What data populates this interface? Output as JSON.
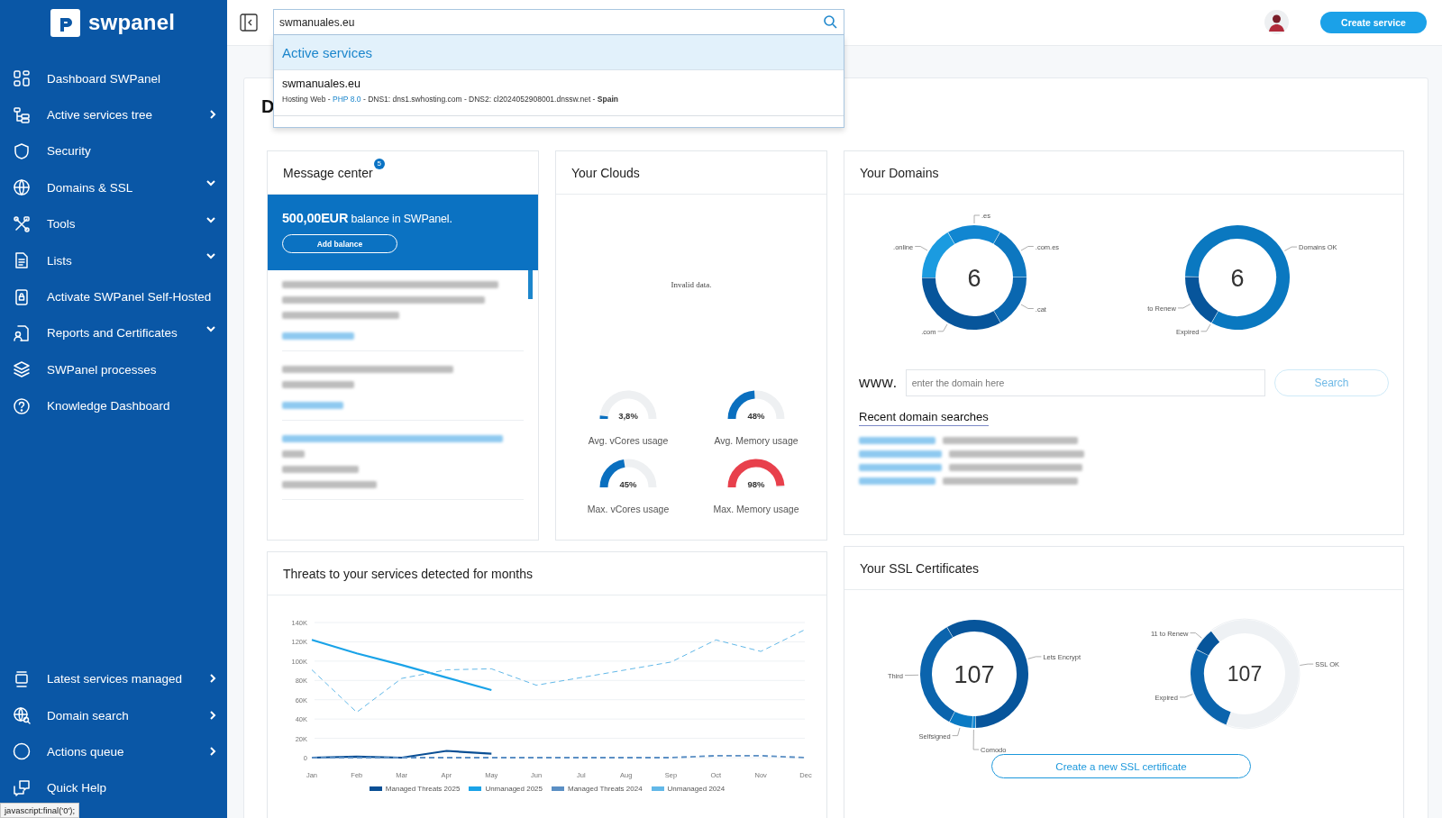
{
  "sidebar": {
    "logo_text": "swpanel",
    "items": [
      {
        "label": "Dashboard SWPanel",
        "kind": "link"
      },
      {
        "label": "Active services tree",
        "kind": "submenu"
      },
      {
        "label": "Security",
        "kind": "link"
      },
      {
        "label": "Domains & SSL",
        "kind": "dropdown"
      },
      {
        "label": "Tools",
        "kind": "dropdown"
      },
      {
        "label": "Lists",
        "kind": "dropdown"
      },
      {
        "label": "Activate SWPanel Self-Hosted",
        "kind": "link"
      },
      {
        "label": "Reports and Certificates",
        "kind": "dropdown"
      },
      {
        "label": "SWPanel processes",
        "kind": "link"
      },
      {
        "label": "Knowledge Dashboard",
        "kind": "link"
      }
    ],
    "bottom_items": [
      {
        "label": "Latest services managed",
        "kind": "submenu"
      },
      {
        "label": "Domain search",
        "kind": "submenu"
      },
      {
        "label": "Actions queue",
        "kind": "submenu"
      },
      {
        "label": "Quick Help",
        "kind": "link"
      }
    ]
  },
  "header": {
    "search_value": "swmanuales.eu",
    "create_button": "Create service"
  },
  "search_results": {
    "group": "Active services",
    "results": [
      {
        "title": "swmanuales.eu",
        "detail_parts": [
          {
            "kind": "plain",
            "text": "Hosting Web - "
          },
          {
            "kind": "accent",
            "text": "PHP 8.0"
          },
          {
            "kind": "plain",
            "text": " - DNS1: dns1.swhosting.com - DNS2: cl2024052908001.dnssw.net - "
          },
          {
            "kind": "bold",
            "text": "Spain"
          }
        ]
      }
    ]
  },
  "page_heading": "D",
  "message_center": {
    "title": "Message center",
    "badge": "5",
    "balance": "**500,00EUR** balance in SWPanel.",
    "button": "Add balance"
  },
  "clouds": {
    "title": "Your Clouds",
    "notice": "Invalid data.",
    "gauges": [
      {
        "label": "Avg. vCores usage",
        "reading": "3,8%",
        "level": 0.038,
        "color": "#0a6fbf"
      },
      {
        "label": "Avg. Memory usage",
        "reading": "48%",
        "level": 0.48,
        "color": "#0a6fbf"
      },
      {
        "label": "Max. vCores usage",
        "reading": "45%",
        "level": 0.45,
        "color": "#0a6fbf"
      },
      {
        "label": "Max. Memory usage",
        "reading": "98%",
        "level": 0.98,
        "color": "#e8404c"
      }
    ]
  },
  "domains": {
    "title": "Your Domains",
    "charts": [
      {
        "center": "6",
        "labels": [
          ".online",
          ".es",
          ".com.es",
          ".cat",
          ".com"
        ]
      },
      {
        "center": "6",
        "labels": [
          "Expired",
          "to Renew",
          "Domains OK"
        ]
      }
    ],
    "www_label": "www.",
    "input_placeholder": "enter the domain here",
    "search_button": "Search",
    "recent_title": "Recent domain searches"
  },
  "threats": {
    "title": "Threats to your services detected for months",
    "chart_data": {
      "type": "line",
      "x": [
        "Jan",
        "Feb",
        "Mar",
        "Apr",
        "May",
        "Jun",
        "Jul",
        "Aug",
        "Sep",
        "Oct",
        "Nov",
        "Dec"
      ],
      "ylim": [
        0,
        140000
      ],
      "yticks": [
        {
          "value": 0,
          "label": "0"
        },
        {
          "value": 20000,
          "label": "20K"
        },
        {
          "value": 40000,
          "label": "40K"
        },
        {
          "value": 60000,
          "label": "60K"
        },
        {
          "value": 80000,
          "label": "80K"
        },
        {
          "value": 100000,
          "label": "100K"
        },
        {
          "value": 120000,
          "label": "120K"
        },
        {
          "value": 140000,
          "label": "140K"
        }
      ],
      "grid": true,
      "legend": "bottom",
      "series": [
        {
          "name": "Managed Threats 2025",
          "color": "#0a4f95",
          "line_style": "solid",
          "values": [
            0,
            1000,
            0,
            7000,
            4000,
            null,
            null,
            null,
            null,
            null,
            null,
            null
          ]
        },
        {
          "name": "Unmanaged 2025",
          "color": "#1aa3e8",
          "line_style": "solid",
          "values": [
            122000,
            108000,
            96000,
            83000,
            70000,
            null,
            null,
            null,
            null,
            null,
            null,
            null
          ]
        },
        {
          "name": "Managed Threats 2024",
          "color": "#5b8fc4",
          "line_style": "dashed",
          "values": [
            0,
            0,
            0,
            0,
            0,
            0,
            0,
            0,
            0,
            2000,
            2000,
            0
          ]
        },
        {
          "name": "Unmanaged 2024",
          "color": "#62b8e8",
          "line_style": "dashed",
          "values": [
            91000,
            47000,
            82000,
            91000,
            92000,
            75000,
            83000,
            91000,
            99000,
            122000,
            110000,
            133000
          ]
        }
      ]
    }
  },
  "ssl": {
    "title": "Your SSL Certificates",
    "charts": [
      {
        "center": "107",
        "labels": [
          "Lets Encrypt",
          "Comodo",
          "Selfsigned",
          "Third"
        ]
      },
      {
        "center": "107",
        "labels": [
          "Expired",
          "11 to Renew",
          "SSL OK"
        ]
      }
    ],
    "button": "Create a new SSL certificate"
  },
  "status_bar": {
    "text": "javascript:final('0');"
  }
}
